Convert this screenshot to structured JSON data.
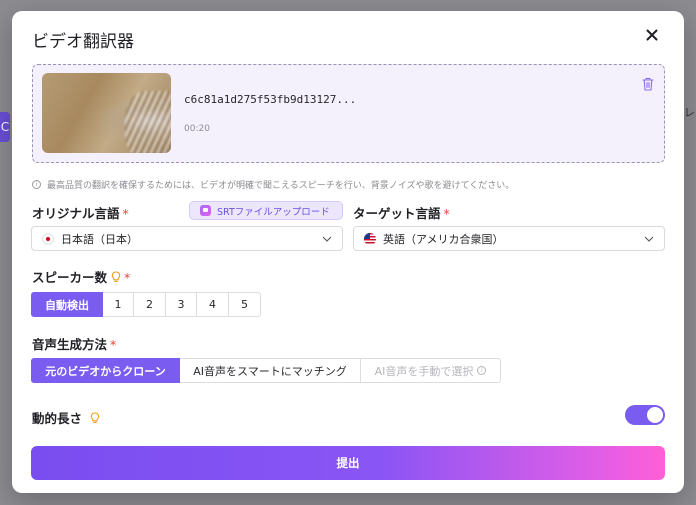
{
  "dialog": {
    "title": "ビデオ翻訳器",
    "close_icon": "close-icon"
  },
  "upload": {
    "file_name": "c6c81a1d275f53fb9d13127...",
    "duration": "00:20",
    "delete_icon": "trash-icon"
  },
  "hint": "最高品質の翻訳を確保するためには、ビデオが明確で聞こえるスピーチを行い、背景ノイズや歌を避けてください。",
  "original_language": {
    "label": "オリジナル言語",
    "required_mark": "*",
    "srt_button_label": "SRTファイルアップロード",
    "selected": "日本語（日本）",
    "flag_icon": "japan-flag-icon"
  },
  "target_language": {
    "label": "ターゲット言語",
    "required_mark": "*",
    "selected": "英語（アメリカ合衆国）",
    "flag_icon": "us-flag-icon"
  },
  "speakers": {
    "label": "スピーカー数",
    "required_mark": "*",
    "options": [
      "自動検出",
      "1",
      "2",
      "3",
      "4",
      "5"
    ],
    "selected": "自動検出"
  },
  "voice_method": {
    "label": "音声生成方法",
    "required_mark": "*",
    "options": [
      "元のビデオからクローン",
      "AI音声をスマートにマッチング",
      "AI音声を手動で選択"
    ],
    "selected": "元のビデオからクローン"
  },
  "dynamic_length": {
    "label": "動的長さ",
    "enabled": true
  },
  "submit_label": "提出",
  "colors": {
    "accent": "#7b5cf0",
    "required": "#e2453c",
    "submit_gradient_end": "#ff5fd6"
  }
}
